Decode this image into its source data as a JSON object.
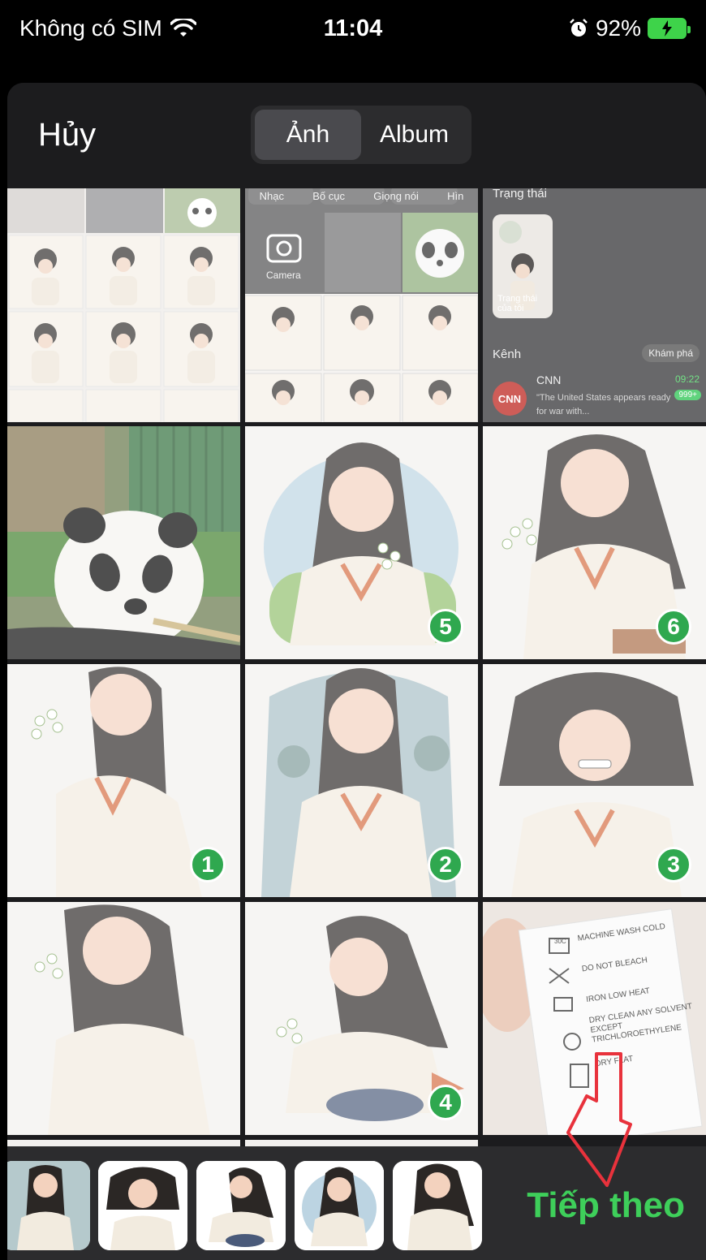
{
  "status_bar": {
    "carrier": "Không có SIM",
    "time": "11:04",
    "battery": "92%"
  },
  "header": {
    "cancel_label": "Hủy",
    "tabs": [
      {
        "label": "Ảnh",
        "active": true
      },
      {
        "label": "Album",
        "active": false
      }
    ]
  },
  "screenshot_cell_1": {
    "tabs": [
      "Nhạc",
      "Bố cục",
      "Giọng nói",
      "Hìn"
    ],
    "camera_label": "Camera"
  },
  "screenshot_cell_2": {
    "status_title": "Trạng thái",
    "my_status": "Trạng thái của tôi",
    "channels_label": "Kênh",
    "explore_label": "Khám phá",
    "channel_name": "CNN",
    "channel_time": "09:22",
    "channel_count": "999+",
    "channel_preview": "\"The United States appears ready for war with..."
  },
  "laundry_label": {
    "lines": [
      "MACHINE WASH COLD",
      "DO NOT BLEACH",
      "IRON LOW HEAT",
      "DRY CLEAN ANY SOLVENT EXCEPT TRICHLOROETHYLENE",
      "DRY FLAT"
    ],
    "temp": "30C"
  },
  "selection_badges": [
    "1",
    "2",
    "3",
    "4",
    "5",
    "6"
  ],
  "footer": {
    "next_label": "Tiếp theo"
  },
  "colors": {
    "accent_green": "#3ecf5a",
    "badge_green": "#2fa84f",
    "annotation_red": "#e8323c"
  }
}
